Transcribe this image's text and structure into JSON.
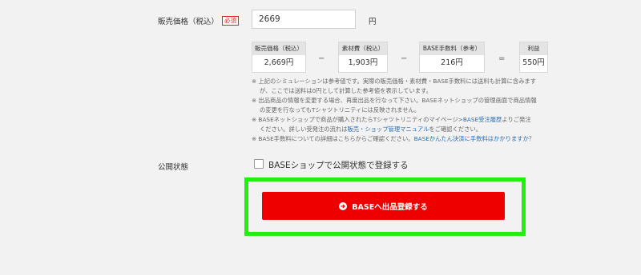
{
  "price_field": {
    "label": "販売価格（税込）",
    "required_badge": "必須",
    "value": "2669",
    "unit": "円"
  },
  "simulation": {
    "items": [
      {
        "header": "販売価格（税込）",
        "value": "2,669円"
      },
      {
        "header": "素材費（税込）",
        "value": "1,903円"
      },
      {
        "header": "BASE手数料（参考）",
        "value": "216円"
      },
      {
        "header": "利益",
        "value": "550円"
      }
    ],
    "ops": [
      "−",
      "−",
      "="
    ]
  },
  "notes": {
    "n1_line1": "※ 上記のシミュレーションは参考値です。実際の販売価格・素材費・BASE手数料には送料も計算に含みます",
    "n1_line2": "が、ここでは送料は0円として計算した参考値を表示しています。",
    "n2_line1": "※ 出品商品の情報を変更する場合、再度出品を行なって下さい。BASEネットショップの管理画面で商品情報",
    "n2_line2": "の変更を行なってもTシャツトリニティには反映されません。",
    "n3_pre": "※ BASEネットショップで商品が購入されたらTシャツトリニティのマイページ>",
    "n3_link1": "BASE受注履歴",
    "n3_post": "よりご発注",
    "n3_line2_pre": "ください。詳しい受発注の流れは",
    "n3_link2": "販売・ショップ管理マニュアル",
    "n3_line2_post": "をご確認ください。",
    "n4_pre": "※ BASE手数料についての詳細はこちらからご確認ください。",
    "n4_link": "BASEかんたん決済に手数料はかかりますか",
    "n4_post": "？"
  },
  "publish": {
    "label": "公開状態",
    "checkbox_label": "BASEショップで公開状態で登録する",
    "checked": false
  },
  "submit_button": {
    "label": "BASEへ出品登録する"
  },
  "colors": {
    "accent": "#ee0000",
    "highlight": "#22ee10",
    "link": "#2a6fb3"
  }
}
